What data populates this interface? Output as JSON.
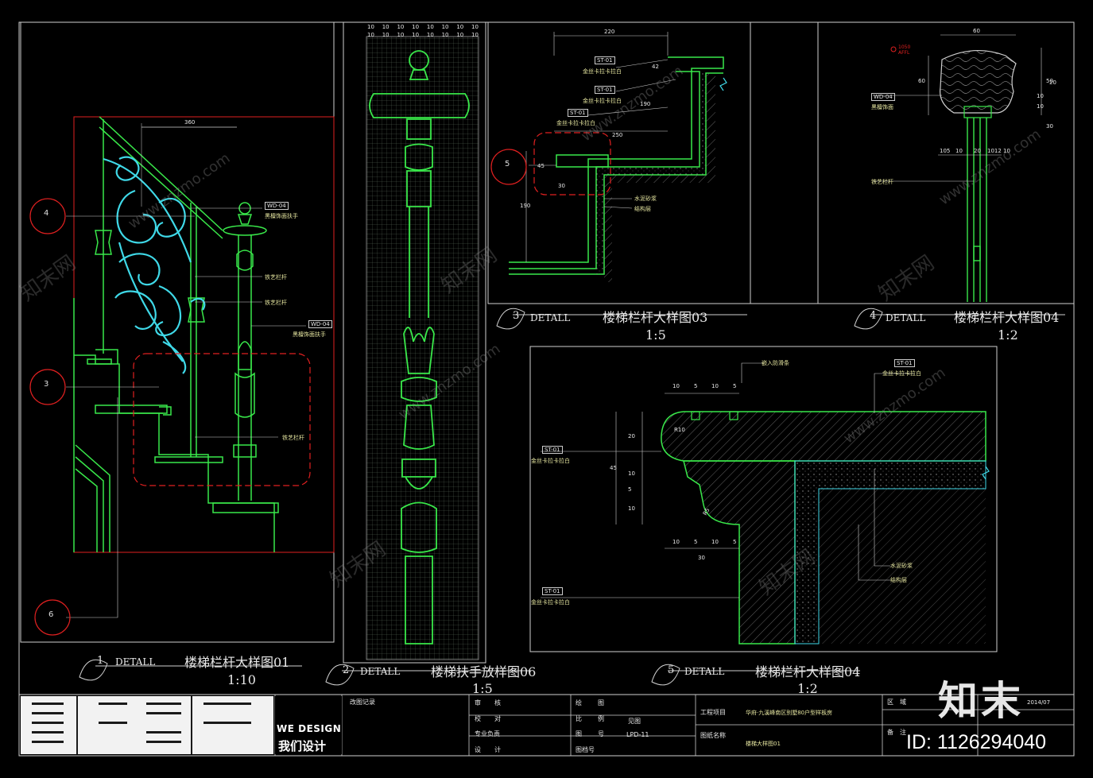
{
  "drawing": {
    "details": [
      {
        "num": "1",
        "word": "DETALL",
        "title": "楼梯栏杆大样图01",
        "scale": "1:10"
      },
      {
        "num": "2",
        "word": "DETALL",
        "title": "楼梯扶手放样图06",
        "scale": "1:5"
      },
      {
        "num": "3",
        "word": "DETALL",
        "title": "楼梯栏杆大样图03",
        "scale": "1:5"
      },
      {
        "num": "4",
        "word": "DETALL",
        "title": "楼梯栏杆大样图04",
        "scale": "1:2"
      },
      {
        "num": "5",
        "word": "DETALL",
        "title": "楼梯栏杆大样图04",
        "scale": "1:2"
      }
    ],
    "callouts": [
      "4",
      "3",
      "6",
      "5"
    ],
    "d1": {
      "dim_top": "360",
      "tags": [
        "WD-04",
        "WD-04"
      ],
      "labels": [
        "黑檀饰面扶手",
        "铁艺栏杆",
        "铁艺栏杆",
        "黑檀饰面扶手",
        "铁艺栏杆"
      ]
    },
    "d2": {
      "grid_nums": [
        "10",
        "10",
        "10",
        "10",
        "10",
        "10",
        "10",
        "10",
        "10",
        "10",
        "10",
        "10",
        "10",
        "10",
        "10",
        "10"
      ]
    },
    "d3": {
      "dims": [
        "220",
        "42",
        "190",
        "250",
        "45",
        "30",
        "190"
      ],
      "tags": [
        "ST-01",
        "ST-01",
        "ST-01"
      ],
      "labels": [
        "金丝卡拉卡拉白",
        "金丝卡拉卡拉白",
        "金丝卡拉卡拉白",
        "水泥砂浆",
        "结构层"
      ]
    },
    "d4": {
      "dims": [
        "60",
        "60",
        "50",
        "10",
        "10",
        "30",
        "105",
        "10",
        "20",
        "1012",
        "10",
        "20"
      ],
      "level": "1050 AFFL",
      "tag": "WD-04",
      "labels": [
        "黑檀饰面",
        "铁艺栏杆"
      ]
    },
    "d5": {
      "dims": [
        "10",
        "5",
        "10",
        "5",
        "20",
        "45",
        "10",
        "5",
        "10",
        "10",
        "5",
        "10",
        "5",
        "30"
      ],
      "radii": [
        "R10",
        "R5"
      ],
      "tags": [
        "ST-01",
        "ST-01",
        "ST-01"
      ],
      "labels": [
        "嵌入防滑条",
        "金丝卡拉卡拉白",
        "金丝卡拉卡拉白",
        "金丝卡拉卡拉白",
        "水泥砂浆",
        "结构层"
      ]
    }
  },
  "titleblock": {
    "brand_en": "WE DESIGN",
    "brand_cn": "我们设计",
    "revision_label": "改图记录",
    "col_a": [
      "审",
      "核",
      "校",
      "对",
      "专业负责",
      "设",
      "计"
    ],
    "col_b": [
      "绘",
      "图",
      "比",
      "例",
      "图",
      "号",
      "图档号"
    ],
    "scale_value": "见图",
    "drawing_no": "LPD-11",
    "project_label": "工程项目",
    "project_name": "华府·九溪峰南区别墅80户型样板房",
    "drawing_name_label": "图纸名称",
    "drawing_name": "楼梯大样图01",
    "area_label": "区　域",
    "date": "2014/07",
    "note_label": "备　注"
  },
  "watermark": {
    "site": "www.znzmo.com",
    "cn": "知末网",
    "logo": "知末",
    "id": "ID: 1126294040"
  },
  "colors": {
    "green": "#39e84a",
    "cyan": "#3fd9e8",
    "red": "#e02020",
    "yellow": "#e6e6a0"
  }
}
